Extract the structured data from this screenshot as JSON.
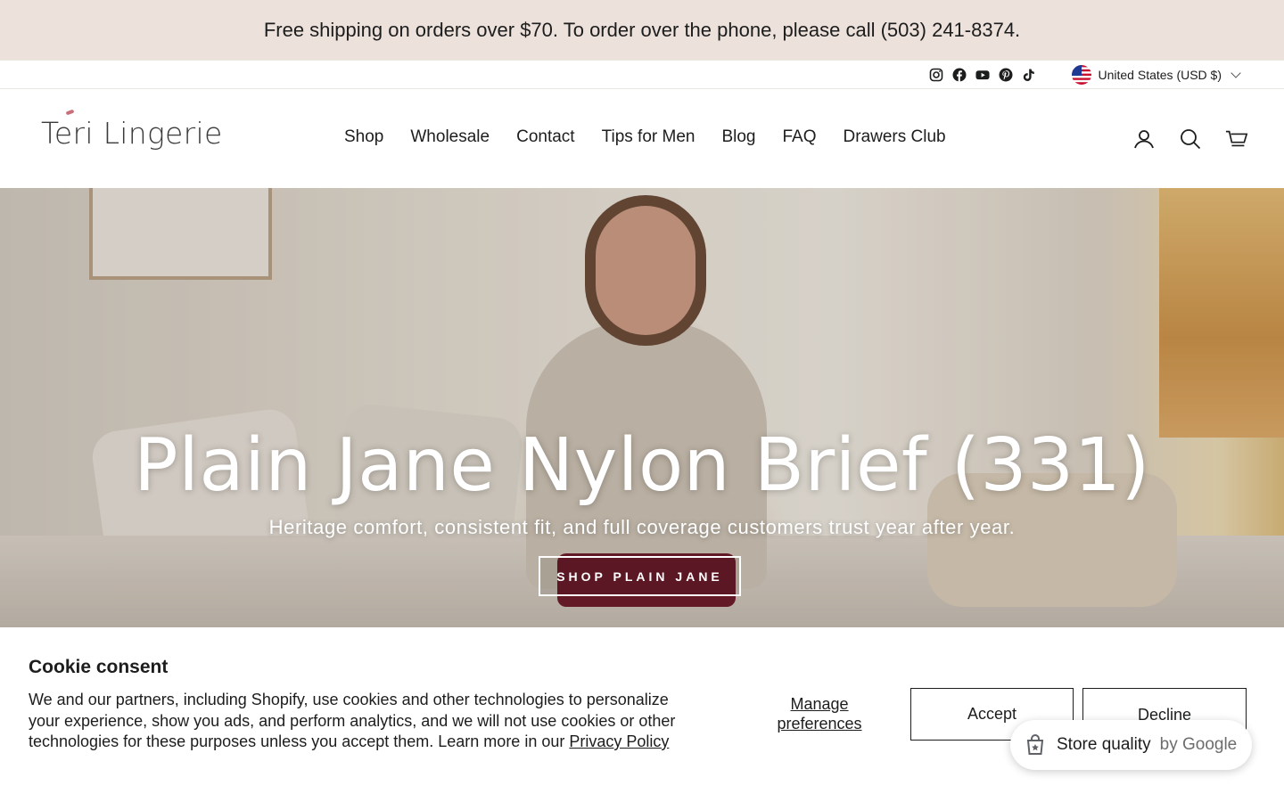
{
  "announcement": {
    "text": "Free shipping on orders over $70. To order over the phone, please call (503) 241-8374."
  },
  "utility": {
    "socials": [
      "instagram-icon",
      "facebook-icon",
      "youtube-icon",
      "pinterest-icon",
      "tiktok-icon"
    ],
    "currency_label": "United States (USD $)"
  },
  "header": {
    "logo_text": "Teri Lingerie",
    "nav": [
      {
        "label": "Shop"
      },
      {
        "label": "Wholesale"
      },
      {
        "label": "Contact"
      },
      {
        "label": "Tips for Men"
      },
      {
        "label": "Blog"
      },
      {
        "label": "FAQ"
      },
      {
        "label": "Drawers Club"
      }
    ],
    "icons": [
      "account-icon",
      "search-icon",
      "cart-icon"
    ]
  },
  "hero": {
    "title": "Plain Jane Nylon Brief (331)",
    "subtitle": "Heritage comfort, consistent fit, and full coverage customers trust year after year.",
    "button_label": "SHOP PLAIN JANE"
  },
  "cookie": {
    "title": "Cookie consent",
    "text": "We and our partners, including Shopify, use cookies and other technologies to personalize your experience, show you ads, and perform analytics, and we will not use cookies or other technologies for these purposes unless you accept them. Learn more in our ",
    "link_label": "Privacy Policy",
    "manage_label": "Manage preferences",
    "accept_label": "Accept",
    "decline_label": "Decline"
  },
  "google_badge": {
    "label": "Store quality",
    "by": "by Google"
  },
  "colors": {
    "announcement_bg": "#ede1dc",
    "text": "#1c1d1d",
    "logo_accent": "#c86f7a"
  }
}
